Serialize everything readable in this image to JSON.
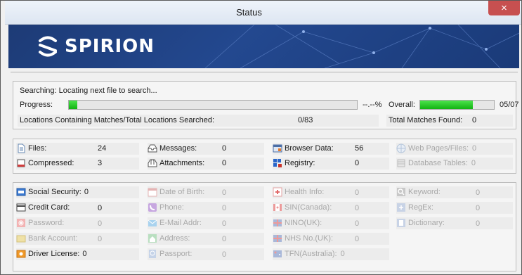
{
  "window": {
    "title": "Status",
    "close_label": "×"
  },
  "brand": {
    "name": "SPIRION"
  },
  "search": {
    "status": "Searching: Locating next file to search...",
    "progress_label": "Progress:",
    "progress_fraction": 0.03,
    "progress_text": "--.--%",
    "overall_label": "Overall:",
    "overall_fraction": 0.71,
    "overall_value": "05/07",
    "locations_label": "Locations Containing Matches/Total Locations Searched:",
    "locations_value": "0/83",
    "total_matches_label": "Total Matches Found:",
    "total_matches_value": "0"
  },
  "locations": {
    "files": {
      "label": "Files:",
      "value": "24"
    },
    "compressed": {
      "label": "Compressed:",
      "value": "3"
    },
    "messages": {
      "label": "Messages:",
      "value": "0"
    },
    "attachments": {
      "label": "Attachments:",
      "value": "0"
    },
    "browser_data": {
      "label": "Browser Data:",
      "value": "56"
    },
    "registry": {
      "label": "Registry:",
      "value": "0"
    },
    "web_pages": {
      "label": "Web Pages/Files:",
      "value": "0"
    },
    "database_tables": {
      "label": "Database Tables:",
      "value": "0"
    }
  },
  "types": {
    "social_security": {
      "label": "Social Security:",
      "value": "0"
    },
    "credit_card": {
      "label": "Credit Card:",
      "value": "0"
    },
    "password": {
      "label": "Password:",
      "value": "0"
    },
    "bank_account": {
      "label": "Bank Account:",
      "value": "0"
    },
    "driver_license": {
      "label": "Driver License:",
      "value": "0"
    },
    "date_of_birth": {
      "label": "Date of Birth:",
      "value": "0"
    },
    "phone": {
      "label": "Phone:",
      "value": "0"
    },
    "email": {
      "label": "E-Mail Addr:",
      "value": "0"
    },
    "address": {
      "label": "Address:",
      "value": "0"
    },
    "passport": {
      "label": "Passport:",
      "value": "0"
    },
    "health_info": {
      "label": "Health Info:",
      "value": "0"
    },
    "sin_canada": {
      "label": "SIN(Canada):",
      "value": "0"
    },
    "nino_uk": {
      "label": "NINO(UK):",
      "value": "0"
    },
    "nhs_uk": {
      "label": "NHS No.(UK):",
      "value": "0"
    },
    "tfn_australia": {
      "label": "TFN(Australia):",
      "value": "0"
    },
    "keyword": {
      "label": "Keyword:",
      "value": "0"
    },
    "regex": {
      "label": "RegEx:",
      "value": "0"
    },
    "dictionary": {
      "label": "Dictionary:",
      "value": "0"
    }
  },
  "colors": {
    "progress_green": "#22c722",
    "banner_blue": "#1d3b76",
    "close_red": "#c75050",
    "disabled_gray": "#a8a8a8"
  }
}
